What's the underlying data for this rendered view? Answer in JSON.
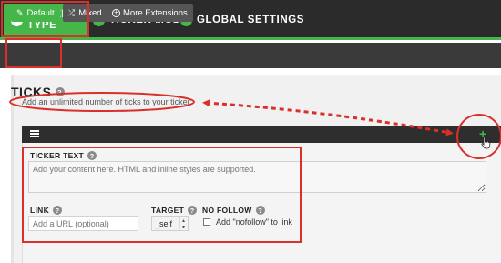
{
  "tabs": [
    {
      "label": "TICKER TYPE",
      "active": true
    },
    {
      "label": "TICKER MODE",
      "active": false
    },
    {
      "label": "GLOBAL SETTINGS",
      "active": false
    }
  ],
  "subtabs": [
    {
      "label": "Default",
      "icon": "pencil-icon",
      "active": true
    },
    {
      "label": "Mixed",
      "icon": "shuffle-icon",
      "active": false
    },
    {
      "label": "More Extensions",
      "icon": "plus-circle-icon",
      "active": false
    }
  ],
  "section": {
    "title": "TICKS",
    "help": "?",
    "description": "Add an unlimited number of ticks to your ticker"
  },
  "tick": {
    "add_label": "+",
    "ticker_text_label": "TICKER TEXT",
    "ticker_text_placeholder": "Add your content here. HTML and inline styles are supported.",
    "link_label": "LINK",
    "link_placeholder": "Add a URL (optional)",
    "target_label": "TARGET",
    "target_value": "_self",
    "nofollow_label": "NO FOLLOW",
    "nofollow_checkbox_label": "Add \"nofollow\" to link",
    "nofollow_checked": false
  },
  "colors": {
    "accent": "#45b649",
    "annotation": "#d9302a",
    "topbar": "#2b2b2b"
  }
}
